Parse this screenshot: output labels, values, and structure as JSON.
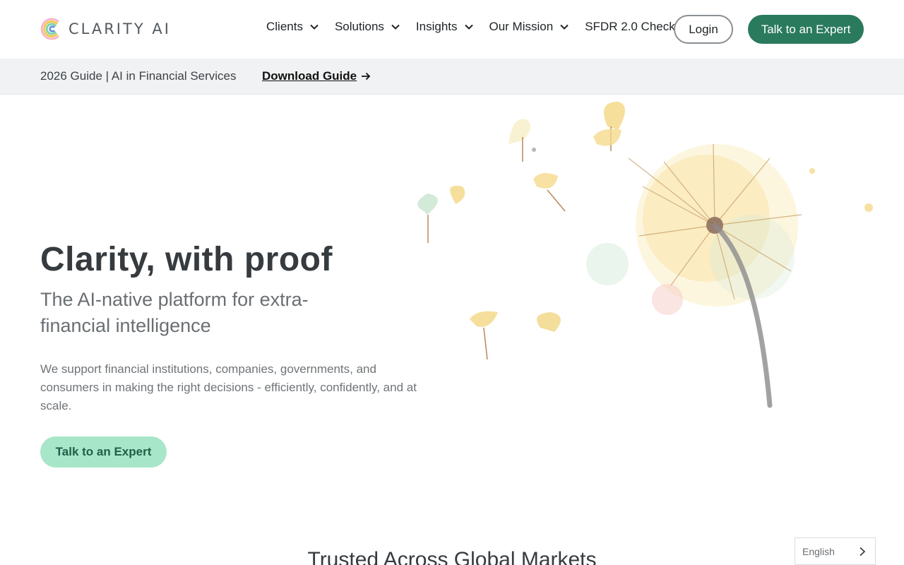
{
  "brand": {
    "name": "CLARITY AI"
  },
  "nav": {
    "items": [
      {
        "label": "Clients",
        "has_dropdown": true
      },
      {
        "label": "Solutions",
        "has_dropdown": true
      },
      {
        "label": "Insights",
        "has_dropdown": true
      },
      {
        "label": "Our Mission",
        "has_dropdown": true
      },
      {
        "label": "SFDR 2.0 Check",
        "has_dropdown": false
      }
    ],
    "login_label": "Login",
    "cta_label": "Talk to an Expert"
  },
  "banner": {
    "text": "2026 Guide | AI in Financial Services",
    "link_label": "Download Guide"
  },
  "hero": {
    "title": "Clarity, with proof",
    "subtitle": "The AI-native platform for extra-financial intelligence",
    "description": "We support financial institutions, companies, governments, and consumers in making the right decisions - efficiently, confidently, and at scale.",
    "cta_label": "Talk to an Expert"
  },
  "section": {
    "heading": "Trusted Across Global Markets"
  },
  "language": {
    "selected": "English"
  },
  "colors": {
    "primary_green": "#2a7a5e",
    "light_green": "#a8e6c9",
    "banner_bg": "#f1f2f3"
  },
  "icons": [
    "clarity-logo-icon",
    "chevron-down-icon",
    "arrow-right-icon",
    "dandelion-illustration",
    "chevron-right-icon"
  ]
}
